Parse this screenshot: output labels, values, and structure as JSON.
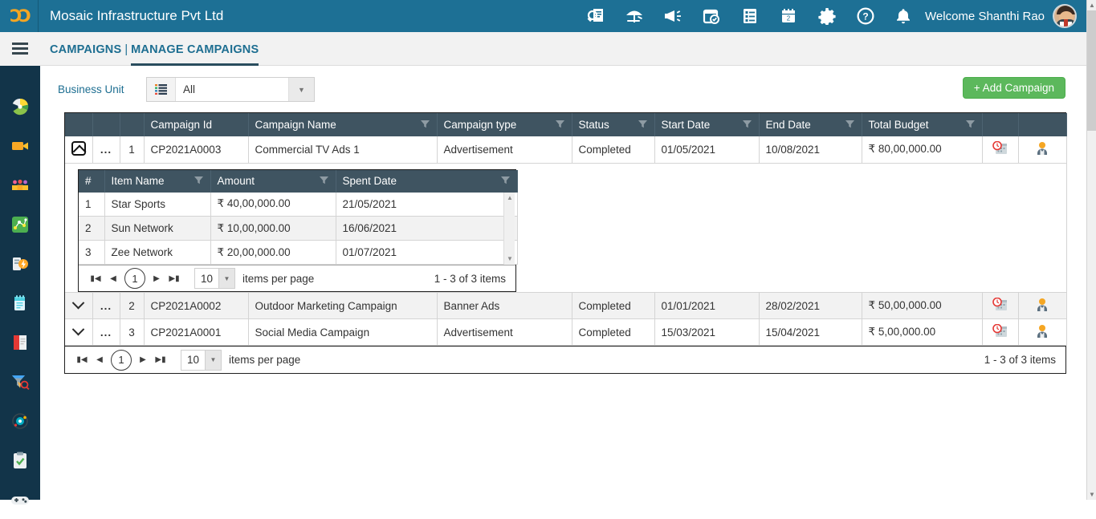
{
  "header": {
    "logo": "cc-logo-icon",
    "app_title": "Mosaic Infrastructure Pvt Ltd",
    "welcome": "Welcome Shanthi Rao",
    "icons": [
      {
        "name": "document-search-icon"
      },
      {
        "name": "umbrella-beach-icon"
      },
      {
        "name": "megaphone-icon"
      },
      {
        "name": "calendar-check-icon"
      },
      {
        "name": "list-report-icon"
      },
      {
        "name": "calendar-date-icon"
      },
      {
        "name": "gear-icon"
      },
      {
        "name": "help-icon"
      }
    ],
    "notification_icon": "bell-icon",
    "avatar": "user-avatar",
    "bar_color": "#1d7095"
  },
  "nav": {
    "menu_icon": "hamburger-icon",
    "breadcrumb_parent": "CAMPAIGNS",
    "breadcrumb_separator": "|",
    "breadcrumb_current": "MANAGE CAMPAIGNS",
    "link_color": "#1d6e91"
  },
  "sidebar": {
    "items": [
      {
        "name": "dashboard-icon"
      },
      {
        "name": "video-camera-icon"
      },
      {
        "name": "people-group-icon"
      },
      {
        "name": "network-map-icon"
      },
      {
        "name": "battery-power-icon"
      },
      {
        "name": "notebook-icon"
      },
      {
        "name": "book-icon"
      },
      {
        "name": "funnel-search-icon"
      },
      {
        "name": "target-orbit-icon"
      },
      {
        "name": "clipboard-check-icon"
      },
      {
        "name": "game-controller-icon"
      }
    ],
    "bg_color": "#123449"
  },
  "filters": {
    "business_unit_label": "Business Unit",
    "business_unit_value": "All",
    "business_unit_icon": "list-icon",
    "dropdown_icon": "chevron-down-icon",
    "add_campaign_label": "+ Add Campaign",
    "add_button_color": "#5cb85c"
  },
  "grid": {
    "columns": [
      {
        "label": "Campaign Id",
        "filterable": false
      },
      {
        "label": "Campaign Name",
        "filterable": true
      },
      {
        "label": "Campaign type",
        "filterable": true
      },
      {
        "label": "Status",
        "filterable": true
      },
      {
        "label": "Start Date",
        "filterable": true
      },
      {
        "label": "End Date",
        "filterable": true
      },
      {
        "label": "Total Budget",
        "filterable": true
      }
    ],
    "rows": [
      {
        "expanded": true,
        "expand_icon": "collapse-icon",
        "menu": "...",
        "index": "1",
        "campaign_id": "CP2021A0003",
        "campaign_name": "Commercial TV Ads 1",
        "campaign_type": "Advertisement",
        "status": "Completed",
        "start_date": "01/05/2021",
        "end_date": "10/08/2021",
        "total_budget": "₹ 80,00,000.00",
        "action_schedule_icon": "calendar-clock-icon",
        "action_user_icon": "person-icon"
      },
      {
        "expanded": false,
        "expand_icon": "chevron-down-icon",
        "menu": "...",
        "index": "2",
        "campaign_id": "CP2021A0002",
        "campaign_name": "Outdoor Marketing Campaign",
        "campaign_type": "Banner Ads",
        "status": "Completed",
        "start_date": "01/01/2021",
        "end_date": "28/02/2021",
        "total_budget": "₹ 50,00,000.00",
        "action_schedule_icon": "calendar-clock-icon",
        "action_user_icon": "person-icon"
      },
      {
        "expanded": false,
        "expand_icon": "chevron-down-icon",
        "menu": "...",
        "index": "3",
        "campaign_id": "CP2021A0001",
        "campaign_name": "Social Media Campaign",
        "campaign_type": "Advertisement",
        "status": "Completed",
        "start_date": "15/03/2021",
        "end_date": "15/04/2021",
        "total_budget": "₹ 5,00,000.00",
        "action_schedule_icon": "calendar-clock-icon",
        "action_user_icon": "person-icon"
      }
    ],
    "header_bg": "#3f5461"
  },
  "subgrid": {
    "columns": [
      {
        "label": "#",
        "filterable": false
      },
      {
        "label": "Item Name",
        "filterable": true
      },
      {
        "label": "Amount",
        "filterable": true
      },
      {
        "label": "Spent Date",
        "filterable": true
      }
    ],
    "rows": [
      {
        "index": "1",
        "item_name": "Star Sports",
        "amount": "₹ 40,00,000.00",
        "spent_date": "21/05/2021"
      },
      {
        "index": "2",
        "item_name": "Sun Network",
        "amount": "₹ 10,00,000.00",
        "spent_date": "16/06/2021"
      },
      {
        "index": "3",
        "item_name": "Zee Network",
        "amount": "₹ 20,00,000.00",
        "spent_date": "01/07/2021"
      }
    ],
    "pager": {
      "first_icon": "first-page-icon",
      "prev_icon": "prev-page-icon",
      "current_page": "1",
      "next_icon": "next-page-icon",
      "last_icon": "last-page-icon",
      "page_size": "10",
      "page_size_arrow": "chevron-down-icon",
      "items_per_page_label": "items per page",
      "range_label": "1 - 3 of 3 items"
    }
  },
  "pager": {
    "first_icon": "first-page-icon",
    "prev_icon": "prev-page-icon",
    "current_page": "1",
    "next_icon": "next-page-icon",
    "last_icon": "last-page-icon",
    "page_size": "10",
    "page_size_arrow": "chevron-down-icon",
    "items_per_page_label": "items per page",
    "range_label": "1 - 3 of 3 items"
  }
}
